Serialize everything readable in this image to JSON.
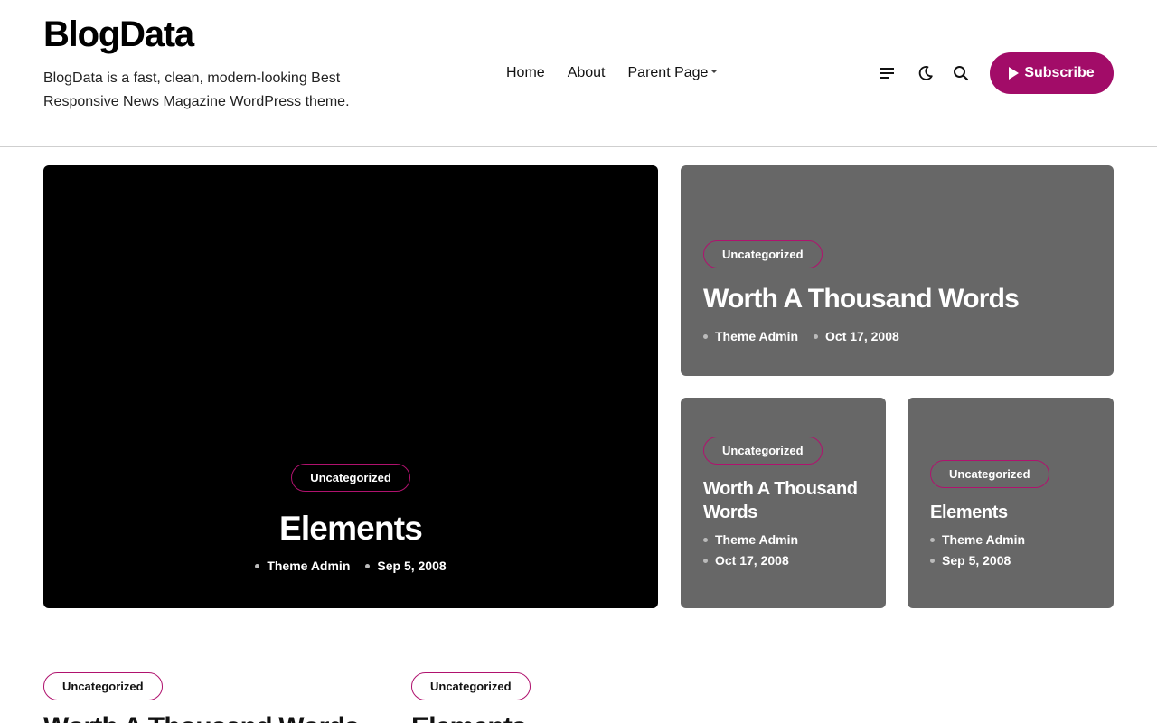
{
  "site": {
    "title": "BlogData",
    "description": "BlogData is a fast, clean, modern-looking Best Responsive News Magazine WordPress theme."
  },
  "nav": {
    "items": [
      {
        "label": "Home"
      },
      {
        "label": "About"
      },
      {
        "label": "Parent Page",
        "has_dropdown": true
      }
    ]
  },
  "header_icons": [
    "menu-icon",
    "moon-icon",
    "search-icon",
    "play-icon"
  ],
  "subscribe": {
    "label": "Subscribe"
  },
  "colors": {
    "accent": "#a20c68",
    "featured_card_bg": "#000000",
    "card_bg": "#676767",
    "divider": "#cfcfcf"
  },
  "featured": {
    "category": "Uncategorized",
    "title": "Elements",
    "author": "Theme Admin",
    "date": "Sep 5, 2008"
  },
  "grid": [
    {
      "category": "Uncategorized",
      "title": "Worth A Thousand Words",
      "author": "Theme Admin",
      "date": "Oct 17, 2008"
    },
    {
      "category": "Uncategorized",
      "title": "Worth A Thousand Words",
      "author": "Theme Admin",
      "date": "Oct 17, 2008"
    },
    {
      "category": "Uncategorized",
      "title": "Elements",
      "author": "Theme Admin",
      "date": "Sep 5, 2008"
    }
  ],
  "list": [
    {
      "category": "Uncategorized",
      "title": "Worth A Thousand Words"
    },
    {
      "category": "Uncategorized",
      "title": "Elements"
    }
  ]
}
